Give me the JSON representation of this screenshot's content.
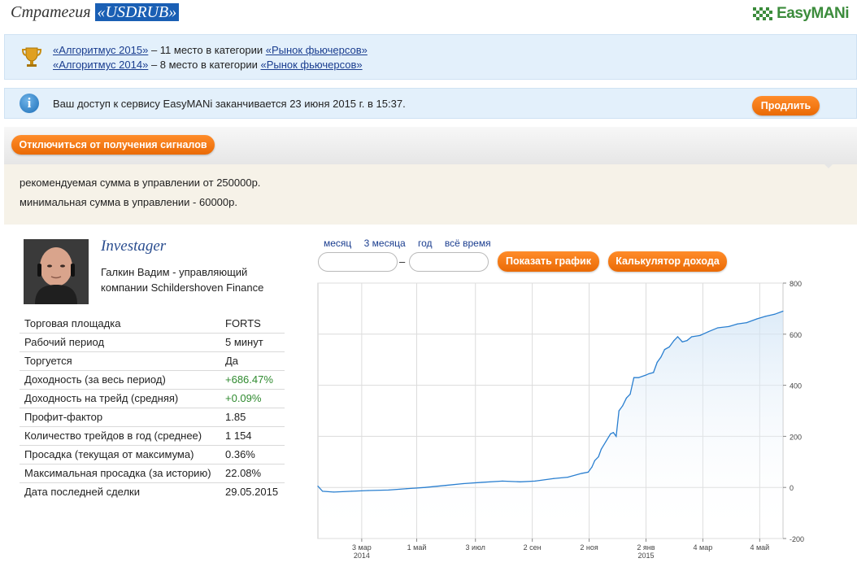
{
  "header": {
    "title_prefix": "Стратегия",
    "title_strategy": "«USDRUB»",
    "logo_text": "EasyMANi"
  },
  "awards": [
    {
      "name": "«Алгоритмус 2015»",
      "text": " – 11 место в категории ",
      "category": "«Рынок фьючерсов»"
    },
    {
      "name": "«Алгоритмус 2014»",
      "text": " – 8 место в категории ",
      "category": "«Рынок фьючерсов»"
    }
  ],
  "access": {
    "message": "Ваш доступ к сервису EasyMANi заканчивается 23 июня 2015 г. в 15:37.",
    "extend_label": "Продлить"
  },
  "signals": {
    "unsubscribe_label": "Отключиться от получения сигналов"
  },
  "recommend": {
    "line1": "рекомендуемая сумма в управлении от 250000р.",
    "line2": "минимальная сумма в управлении - 60000р."
  },
  "trader": {
    "name": "Investager",
    "description": "Галкин Вадим - управляющий компании Schildershoven Finance"
  },
  "stats": [
    {
      "label": "Торговая площадка",
      "value": "FORTS",
      "positive": false
    },
    {
      "label": "Рабочий период",
      "value": "5 минут",
      "positive": false
    },
    {
      "label": "Торгуется",
      "value": "Да",
      "positive": false
    },
    {
      "label": "Доходность (за весь период)",
      "value": "+686.47%",
      "positive": true
    },
    {
      "label": "Доходность на трейд (средняя)",
      "value": "+0.09%",
      "positive": true
    },
    {
      "label": "Профит-фактор",
      "value": "1.85",
      "positive": false
    },
    {
      "label": "Количество трейдов в год (среднее)",
      "value": "1 154",
      "positive": false
    },
    {
      "label": "Просадка (текущая от максимума)",
      "value": "0.36%",
      "positive": false
    },
    {
      "label": "Максимальная просадка (за историю)",
      "value": "22.08%",
      "positive": false
    },
    {
      "label": "Дата последней сделки",
      "value": "29.05.2015",
      "positive": false
    }
  ],
  "chart_controls": {
    "periods": [
      "месяц",
      "3 месяца",
      "год",
      "всё время"
    ],
    "date_from": "",
    "date_to": "",
    "dash": "–",
    "show_chart_label": "Показать график",
    "calculator_label": "Калькулятор дохода"
  },
  "colors": {
    "accent_orange": "#f07a12",
    "link_blue": "#1a3d8f",
    "info_bg": "#e3f0fb",
    "positive_green": "#2f8a2f",
    "line_blue": "#2a7fd0"
  },
  "chart_data": {
    "type": "area",
    "title": "",
    "xlabel": "",
    "ylabel": "",
    "ylim": [
      -200,
      800
    ],
    "yticks": [
      -200,
      0,
      200,
      400,
      600,
      800
    ],
    "xlim": [
      "2014-01-15",
      "2015-05-29"
    ],
    "xticks": [
      {
        "date": "2014-03-03",
        "label": "3 мар",
        "year": "2014"
      },
      {
        "date": "2014-05-01",
        "label": "1 май",
        "year": ""
      },
      {
        "date": "2014-07-03",
        "label": "3 июл",
        "year": ""
      },
      {
        "date": "2014-09-02",
        "label": "2 сен",
        "year": ""
      },
      {
        "date": "2014-11-02",
        "label": "2 ноя",
        "year": ""
      },
      {
        "date": "2015-01-02",
        "label": "2 янв",
        "year": "2015"
      },
      {
        "date": "2015-03-04",
        "label": "4 мар",
        "year": ""
      },
      {
        "date": "2015-05-04",
        "label": "4 май",
        "year": ""
      }
    ],
    "grid": true,
    "y_axis_side": "right",
    "series": [
      {
        "x": [
          "2014-01-15",
          "2014-01-20",
          "2014-02-01",
          "2014-02-20",
          "2014-03-10",
          "2014-04-01",
          "2014-04-20",
          "2014-05-10",
          "2014-06-01",
          "2014-06-20",
          "2014-07-10",
          "2014-08-01",
          "2014-08-20",
          "2014-09-05",
          "2014-09-25",
          "2014-10-10",
          "2014-10-25",
          "2014-11-01",
          "2014-11-05",
          "2014-11-08",
          "2014-11-12",
          "2014-11-15",
          "2014-11-20",
          "2014-11-25",
          "2014-11-28",
          "2014-12-01",
          "2014-12-04",
          "2014-12-08",
          "2014-12-12",
          "2014-12-16",
          "2014-12-20",
          "2014-12-25",
          "2015-01-02",
          "2015-01-05",
          "2015-01-10",
          "2015-01-14",
          "2015-01-18",
          "2015-01-22",
          "2015-01-27",
          "2015-02-01",
          "2015-02-05",
          "2015-02-10",
          "2015-02-15",
          "2015-02-20",
          "2015-03-01",
          "2015-03-10",
          "2015-03-20",
          "2015-04-01",
          "2015-04-10",
          "2015-04-20",
          "2015-05-01",
          "2015-05-10",
          "2015-05-20",
          "2015-05-29"
        ],
        "y": [
          5,
          -15,
          -18,
          -15,
          -12,
          -10,
          -5,
          0,
          8,
          15,
          20,
          25,
          22,
          25,
          35,
          40,
          55,
          60,
          80,
          105,
          120,
          150,
          180,
          210,
          215,
          200,
          300,
          320,
          350,
          365,
          430,
          430,
          440,
          445,
          450,
          490,
          510,
          540,
          550,
          575,
          590,
          570,
          575,
          590,
          595,
          610,
          625,
          630,
          640,
          645,
          660,
          670,
          678,
          690
        ]
      }
    ]
  }
}
